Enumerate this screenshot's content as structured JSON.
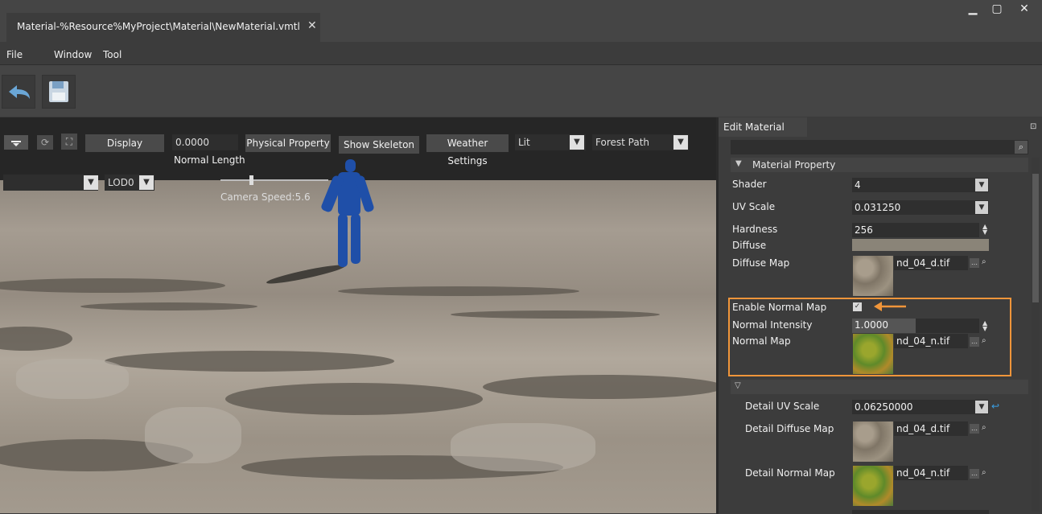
{
  "window": {
    "tab_title": "Material-%Resource%MyProject\\Material\\NewMaterial.vmtl",
    "tab_close": "✕",
    "controls": {
      "minimize": "▁",
      "maximize": "▢",
      "close": "✕"
    }
  },
  "menu": {
    "items": [
      "File",
      "Window",
      "Tool"
    ]
  },
  "toolbar": {
    "undo_icon": "undo-icon",
    "save_icon": "save-icon"
  },
  "viewport": {
    "display_button": "Display",
    "normal_length_value": "0.0000",
    "normal_length_label": "Normal Length",
    "physical_property_button": "Physical Property",
    "show_skeleton_button": "Show Skeleton",
    "weather_settings_button": "Weather Settings",
    "lighting_mode": "Lit",
    "environment": "Forest Path",
    "lod_left": "",
    "lod": "LOD0",
    "camera_speed": "Camera Speed:5.6"
  },
  "panel": {
    "title": "Edit Material",
    "search_placeholder": "",
    "section_title": "Material Property",
    "shader_label": "Shader",
    "shader_value": "4",
    "uv_scale_label": "UV Scale",
    "uv_scale_value": "0.031250",
    "hardness_label": "Hardness",
    "hardness_value": "256",
    "diffuse_label": "Diffuse",
    "diffuse_color": "#8a8478",
    "diffuse_map_label": "Diffuse Map",
    "diffuse_map_file": "nd_04_d.tif",
    "enable_normal_map_label": "Enable Normal Map",
    "enable_normal_map_checked": true,
    "normal_intensity_label": "Normal Intensity",
    "normal_intensity_value": "1.0000",
    "normal_intensity_fraction": 0.5,
    "normal_map_label": "Normal Map",
    "normal_map_file": "nd_04_n.tif",
    "detail_uv_scale_label": "Detail UV Scale",
    "detail_uv_scale_value": "0.06250000",
    "detail_diffuse_map_label": "Detail Diffuse Map",
    "detail_diffuse_map_file": "nd_04_d.tif",
    "detail_normal_map_label": "Detail Normal Map",
    "detail_normal_map_file": "nd_04_n.tif",
    "highlight_color": "#f0953a"
  }
}
